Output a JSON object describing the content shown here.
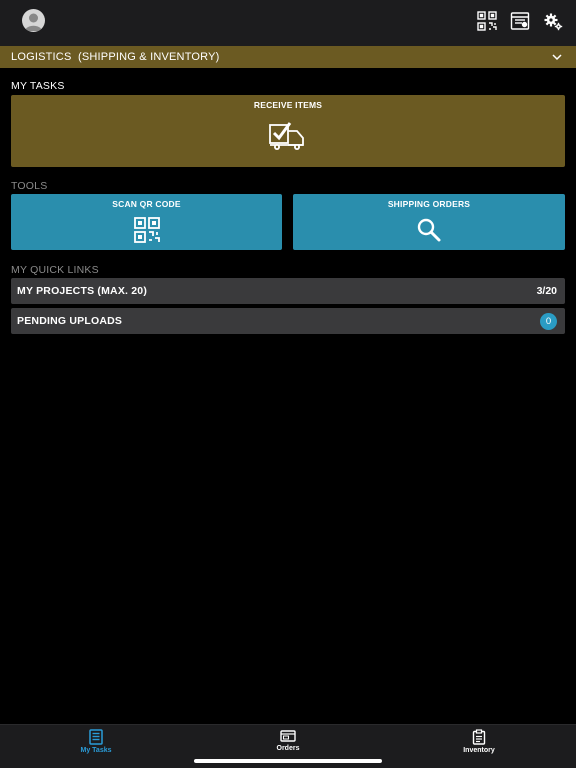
{
  "header": {
    "avatar_icon": "user-avatar-icon",
    "icons": [
      "qr-code-icon",
      "barcode-scanner-icon",
      "settings-gears-icon"
    ]
  },
  "section": {
    "title": "LOGISTICS  (SHIPPING & INVENTORY)",
    "toggle_icon": "chevron-down-icon"
  },
  "my_tasks": {
    "heading": "MY TASKS",
    "receive_items": {
      "label": "RECEIVE ITEMS",
      "icon": "truck-check-icon"
    }
  },
  "tools": {
    "heading": "TOOLS",
    "scan_qr": {
      "label": "SCAN QR CODE",
      "icon": "qr-code-icon"
    },
    "shipping_orders": {
      "label": "SHIPPING ORDERS",
      "icon": "search-icon"
    }
  },
  "quick_links": {
    "heading": "MY QUICK LINKS",
    "projects": {
      "label": "MY PROJECTS (MAX. 20)",
      "count": "3/20"
    },
    "pending": {
      "label": "PENDING UPLOADS",
      "count": "0"
    }
  },
  "tabs": [
    {
      "label": "My Tasks",
      "icon": "task-list-icon",
      "active": true
    },
    {
      "label": "Orders",
      "icon": "orders-icon",
      "active": false
    },
    {
      "label": "Inventory",
      "icon": "clipboard-icon",
      "active": false
    }
  ],
  "colors": {
    "gold": "#6b5a22",
    "teal": "#2a8ead",
    "active_tab": "#2a9cd8",
    "badge": "#2a9cc4"
  }
}
